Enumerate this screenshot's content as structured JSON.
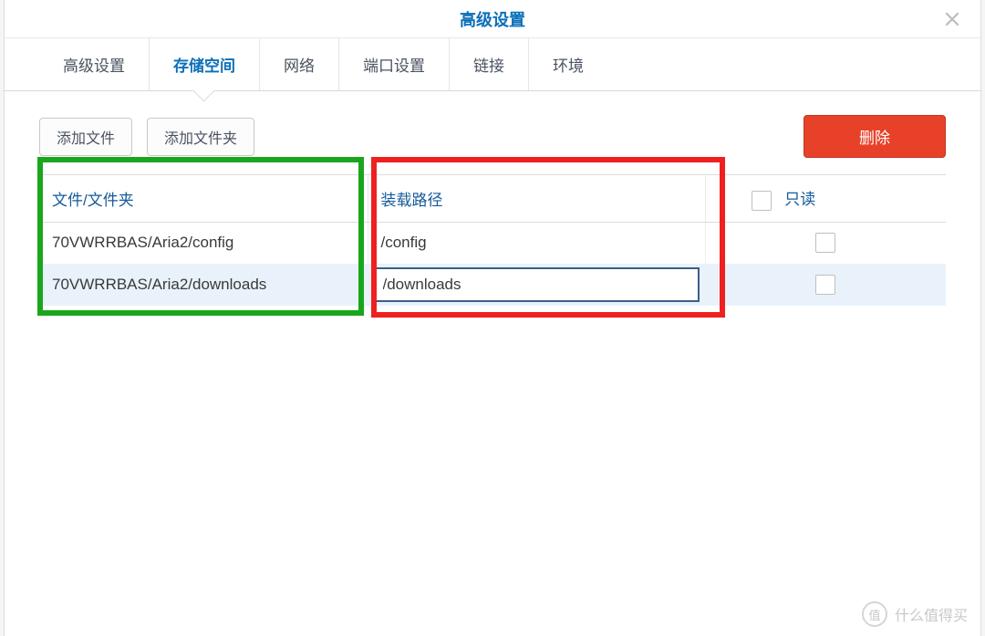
{
  "dialog": {
    "title": "高级设置"
  },
  "tabs": [
    {
      "label": "高级设置"
    },
    {
      "label": "存储空间",
      "active": true
    },
    {
      "label": "网络"
    },
    {
      "label": "端口设置"
    },
    {
      "label": "链接"
    },
    {
      "label": "环境"
    }
  ],
  "toolbar": {
    "add_file_label": "添加文件",
    "add_folder_label": "添加文件夹",
    "delete_label": "删除"
  },
  "table": {
    "headers": {
      "file_folder": "文件/文件夹",
      "mount_path": "装载路径",
      "readonly": "只读"
    },
    "rows": [
      {
        "file_folder": "70VWRRBAS/Aria2/config",
        "mount_path": "/config",
        "readonly": false,
        "selected": false
      },
      {
        "file_folder": "70VWRRBAS/Aria2/downloads",
        "mount_path": "/downloads",
        "readonly": false,
        "selected": true,
        "editing_mount": true
      }
    ]
  },
  "watermark": {
    "badge": "值",
    "text": "什么值得买"
  }
}
